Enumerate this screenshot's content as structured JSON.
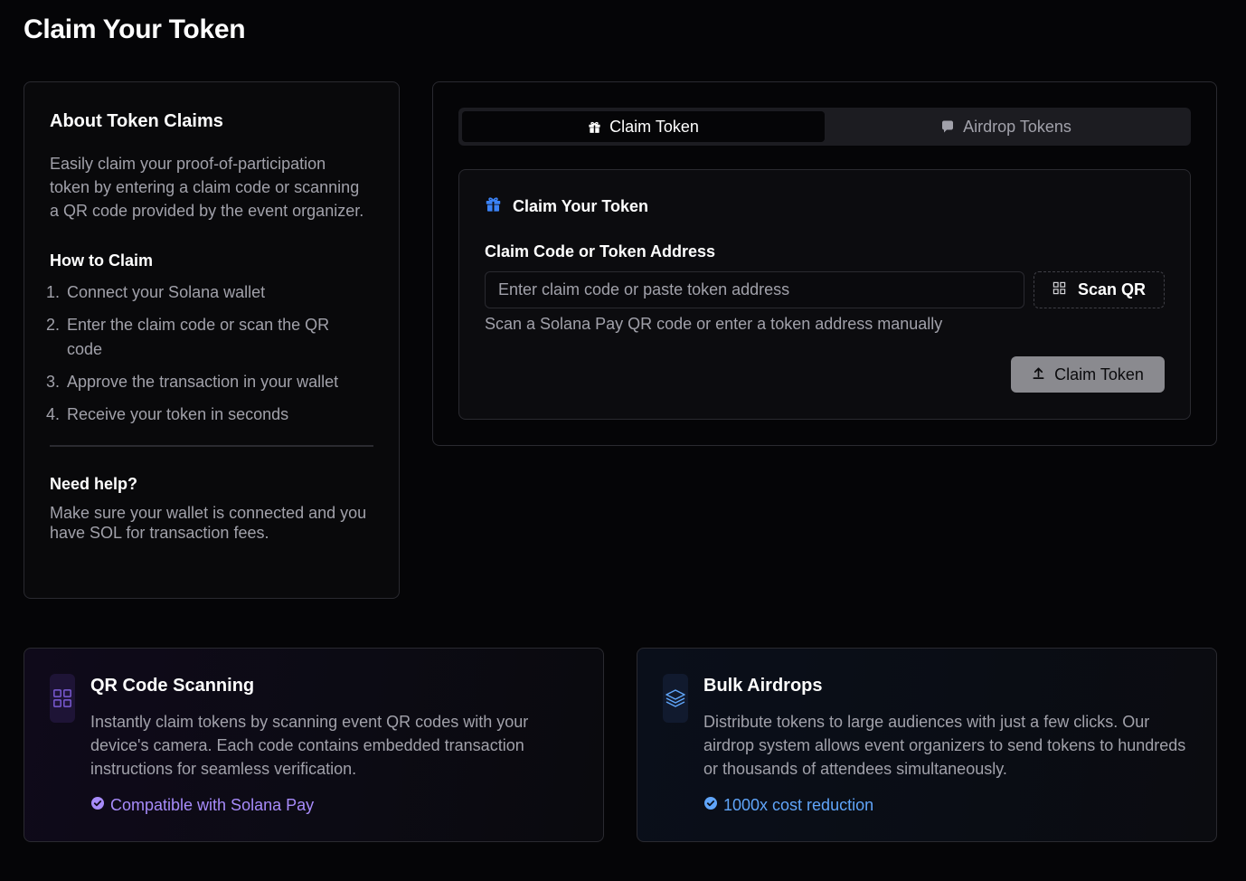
{
  "page": {
    "title": "Claim Your Token"
  },
  "about": {
    "title": "About Token Claims",
    "description": "Easily claim your proof-of-participation token by entering a claim code or scanning a QR code provided by the event organizer.",
    "howto_title": "How to Claim",
    "steps": [
      {
        "num": "1.",
        "text": "Connect your Solana wallet"
      },
      {
        "num": "2.",
        "text": "Enter the claim code or scan the QR code"
      },
      {
        "num": "3.",
        "text": "Approve the transaction in your wallet"
      },
      {
        "num": "4.",
        "text": "Receive your token in seconds"
      }
    ],
    "help_title": "Need help?",
    "help_text": "Make sure your wallet is connected and you have SOL for transaction fees."
  },
  "tabs": [
    {
      "label": "Claim Token",
      "icon": "gift-icon",
      "active": true
    },
    {
      "label": "Airdrop Tokens",
      "icon": "chat-bubble-icon",
      "active": false
    }
  ],
  "claim": {
    "header_title": "Claim Your Token",
    "header_icon": "gift-icon",
    "field_label": "Claim Code or Token Address",
    "input_placeholder": "Enter claim code or paste token address",
    "input_value": "",
    "scan_label": "Scan QR",
    "hint": "Scan a Solana Pay QR code or enter a token address manually",
    "submit_label": "Claim Token",
    "submit_icon": "upload-icon"
  },
  "features": [
    {
      "title": "QR Code Scanning",
      "icon": "qr-grid-icon",
      "description": "Instantly claim tokens by scanning event QR codes with your device's camera. Each code contains embedded transaction instructions for seamless verification.",
      "badge": "Compatible with Solana Pay"
    },
    {
      "title": "Bulk Airdrops",
      "icon": "layers-icon",
      "description": "Distribute tokens to large audiences with just a few clicks. Our airdrop system allows event organizers to send tokens to hundreds or thousands of attendees simultaneously.",
      "badge": "1000x cost reduction"
    }
  ],
  "colors": {
    "background": "#050507",
    "accent_purple": "#a78bfa",
    "accent_blue": "#60a5fa",
    "gift_blue": "#3b82f6",
    "submit_disabled": "#8a8a8f"
  }
}
